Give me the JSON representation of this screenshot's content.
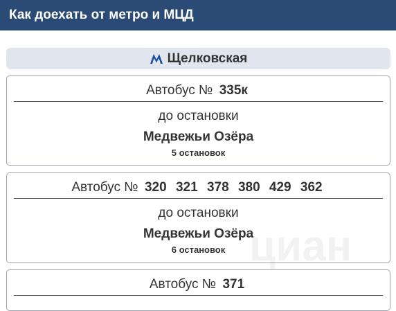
{
  "header": {
    "title": "Как доехать от метро и МЦД"
  },
  "station": {
    "icon": "metro-m-icon",
    "name": "Щелковская",
    "icon_color": "#1b4f9c"
  },
  "routes": [
    {
      "prefix": "Автобус №",
      "numbers": [
        "335к"
      ],
      "to_label": "до остановки",
      "stop": "Медвежьи Озёра",
      "count": "5 остановок"
    },
    {
      "prefix": "Автобус №",
      "numbers": [
        "320",
        "321",
        "378",
        "380",
        "429",
        "362"
      ],
      "to_label": "до остановки",
      "stop": "Медвежьи Озёра",
      "count": "6 остановок"
    },
    {
      "prefix": "Автобус №",
      "numbers": [
        "371"
      ]
    }
  ],
  "watermark": "циан"
}
